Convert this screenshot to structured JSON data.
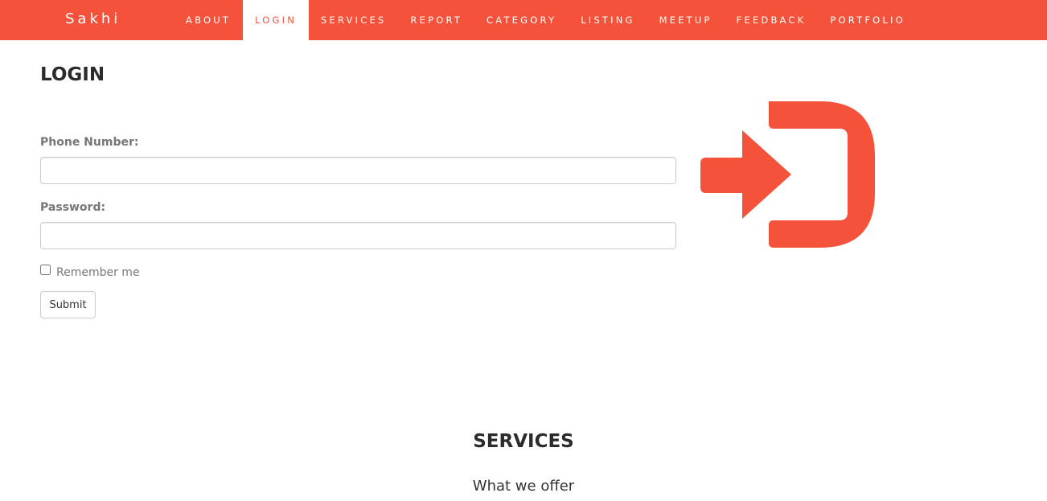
{
  "navbar": {
    "brand": "Sakhi",
    "items": [
      {
        "label": "ABOUT",
        "active": false
      },
      {
        "label": "LOGIN",
        "active": true
      },
      {
        "label": "SERVICES",
        "active": false
      },
      {
        "label": "REPORT",
        "active": false
      },
      {
        "label": "CATEGORY",
        "active": false
      },
      {
        "label": "LISTING",
        "active": false
      },
      {
        "label": "MEETUP",
        "active": false
      },
      {
        "label": "FEEDBACK",
        "active": false
      },
      {
        "label": "PORTFOLIO",
        "active": false
      }
    ]
  },
  "login": {
    "title": "LOGIN",
    "phone_label": "Phone Number:",
    "phone_value": "",
    "password_label": "Password:",
    "password_value": "",
    "remember_label": "Remember me",
    "remember_checked": false,
    "submit_label": "Submit",
    "graphic_icon": "login-arrow-icon"
  },
  "services": {
    "title": "SERVICES",
    "subtitle": "What we offer"
  },
  "colors": {
    "brand": "#f4523a",
    "nav_text": "#ffffff",
    "heading": "#2b2b2b",
    "label": "#777777"
  }
}
